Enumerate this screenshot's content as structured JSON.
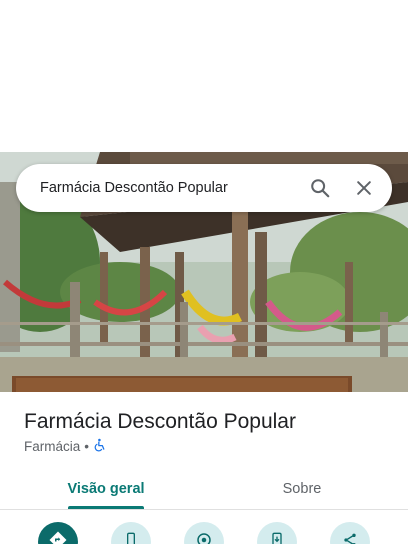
{
  "search": {
    "query": "Farmácia Descontão Popular"
  },
  "place": {
    "name": "Farmácia Descontão Popular",
    "category": "Farmácia",
    "separator": "•"
  },
  "tabs": [
    {
      "label": "Visão geral",
      "active": true
    },
    {
      "label": "Sobre",
      "active": false
    }
  ],
  "actions": [
    {
      "icon": "directions-icon"
    },
    {
      "icon": "phone-icon"
    },
    {
      "icon": "nearby-icon"
    },
    {
      "icon": "send-to-phone-icon"
    },
    {
      "icon": "share-icon"
    }
  ],
  "colors": {
    "accent": "#0b7a75",
    "action_bg": "#d4ecee",
    "primary_action": "#0b6b6a"
  }
}
